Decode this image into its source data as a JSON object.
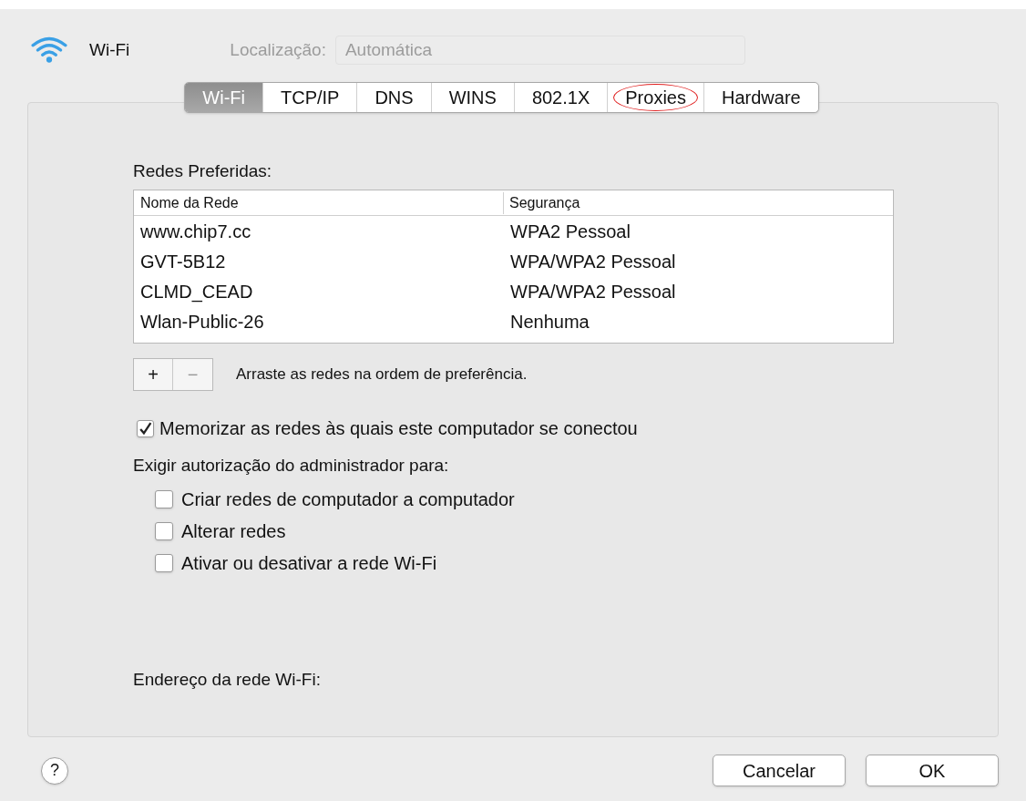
{
  "header": {
    "title": "Wi-Fi",
    "location_label": "Localização:",
    "location_value": "Automática"
  },
  "tabs": [
    {
      "label": "Wi-Fi",
      "selected": true,
      "circled": false
    },
    {
      "label": "TCP/IP",
      "selected": false,
      "circled": false
    },
    {
      "label": "DNS",
      "selected": false,
      "circled": false
    },
    {
      "label": "WINS",
      "selected": false,
      "circled": false
    },
    {
      "label": "802.1X",
      "selected": false,
      "circled": false
    },
    {
      "label": "Proxies",
      "selected": false,
      "circled": true
    },
    {
      "label": "Hardware",
      "selected": false,
      "circled": false
    }
  ],
  "preferred_networks": {
    "title": "Redes Preferidas:",
    "columns": [
      "Nome da Rede",
      "Segurança"
    ],
    "rows": [
      [
        "www.chip7.cc",
        "WPA2 Pessoal"
      ],
      [
        "GVT-5B12",
        "WPA/WPA2 Pessoal"
      ],
      [
        "CLMD_CEAD",
        "WPA/WPA2 Pessoal"
      ],
      [
        "Wlan-Public-26",
        "Nenhuma"
      ]
    ],
    "add_button": "+",
    "remove_button": "−",
    "hint": "Arraste as redes na ordem de preferência."
  },
  "remember": {
    "label": "Memorizar as redes às quais este computador se conectou",
    "checked": true
  },
  "admin": {
    "title": "Exigir autorização do administrador para:",
    "options": [
      {
        "label": "Criar redes de computador a computador",
        "checked": false
      },
      {
        "label": "Alterar redes",
        "checked": false
      },
      {
        "label": "Ativar ou desativar a rede Wi-Fi",
        "checked": false
      }
    ]
  },
  "address_label": "Endereço da rede Wi-Fi:",
  "footer": {
    "help": "?",
    "buttons": [
      "Cancelar",
      "OK"
    ]
  }
}
